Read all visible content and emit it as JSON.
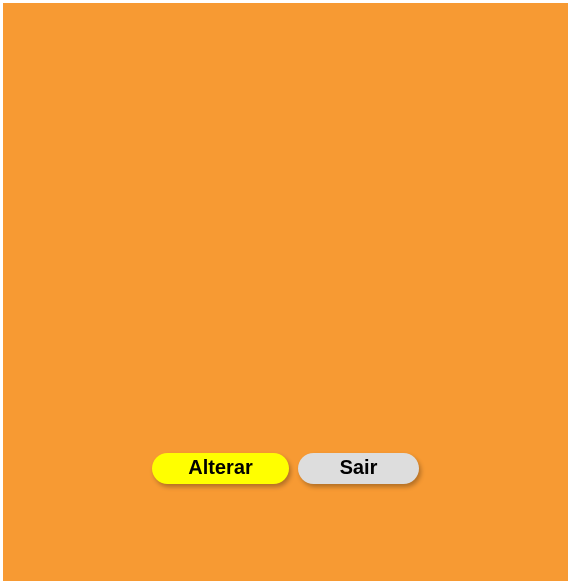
{
  "colors": {
    "background": "#f79a33",
    "alterar_button": "#ffff00",
    "sair_button": "#dddddd"
  },
  "actions": {
    "alterar_label": "Alterar",
    "sair_label": "Sair"
  }
}
